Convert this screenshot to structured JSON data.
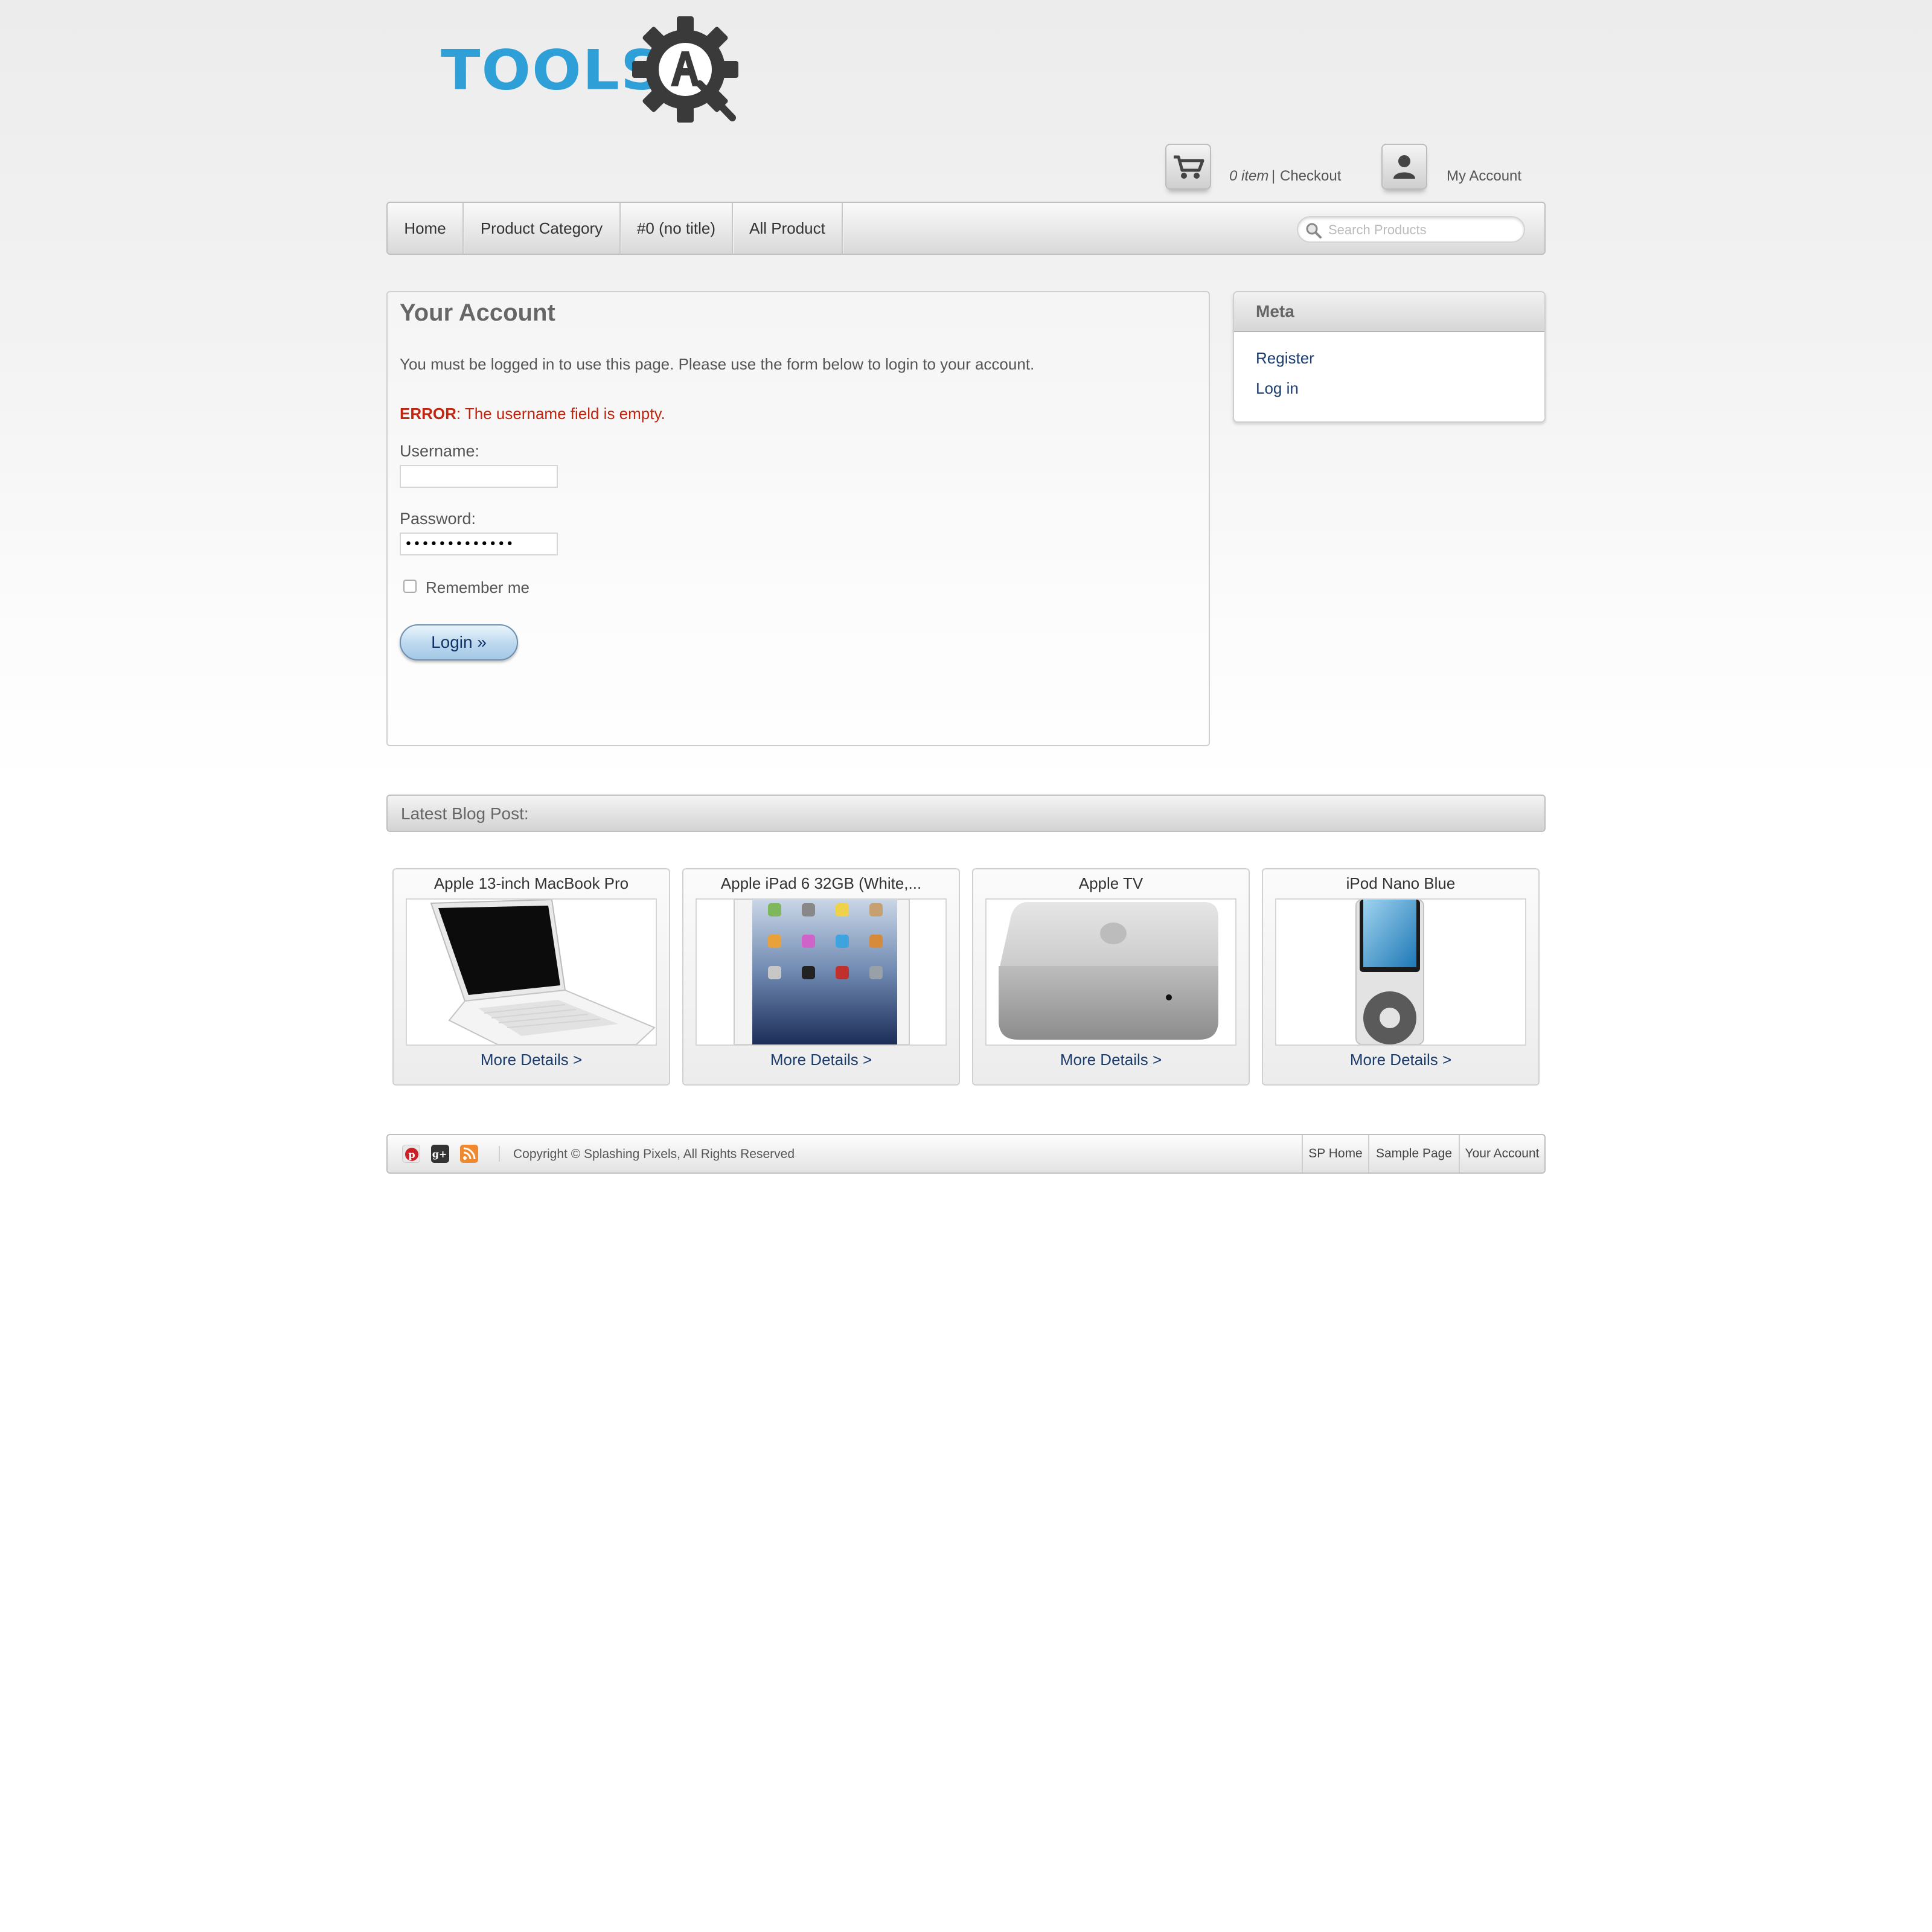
{
  "header": {
    "logo_text": "TOOLS",
    "logo_badge_letter": "A",
    "cart_count": "0 item",
    "cart_separator": "|",
    "checkout_label": "Checkout",
    "my_account_label": "My Account"
  },
  "nav": {
    "items": [
      {
        "label": "Home"
      },
      {
        "label": "Product Category"
      },
      {
        "label": "#0 (no title)"
      },
      {
        "label": "All Product"
      }
    ],
    "search_placeholder": "Search Products"
  },
  "account": {
    "title": "Your Account",
    "message": "You must be logged in to use this page. Please use the form below to login to your account.",
    "error_label": "ERROR",
    "error_text": ": The username field is empty.",
    "username_label": "Username:",
    "username_value": "",
    "password_label": "Password:",
    "password_value": "•••••••••••••",
    "remember_label": "Remember me",
    "login_button": "Login »"
  },
  "meta": {
    "title": "Meta",
    "links": [
      {
        "label": "Register"
      },
      {
        "label": "Log in"
      }
    ]
  },
  "blog": {
    "heading": "Latest Blog Post:",
    "products": [
      {
        "title": "Apple 13-inch MacBook Pro",
        "link": "More Details >",
        "image_icon": "laptop-image"
      },
      {
        "title": "Apple iPad 6 32GB (White,...",
        "link": "More Details >",
        "image_icon": "tablet-image"
      },
      {
        "title": "Apple TV",
        "link": "More Details >",
        "image_icon": "apple-tv-image"
      },
      {
        "title": "iPod Nano Blue",
        "link": "More Details >",
        "image_icon": "ipod-image"
      }
    ]
  },
  "footer": {
    "social_icons": [
      "pinterest-icon",
      "google-plus-icon",
      "rss-icon"
    ],
    "copyright": "Copyright © Splashing Pixels, All Rights Reserved",
    "links": [
      {
        "label": "SP Home"
      },
      {
        "label": "Sample Page"
      },
      {
        "label": "Your Account"
      }
    ]
  },
  "colors": {
    "logo_blue": "#2f9fd8",
    "logo_gear": "#3a3a3a",
    "error_red": "#c0260f",
    "link_blue": "#1c3e6e"
  }
}
